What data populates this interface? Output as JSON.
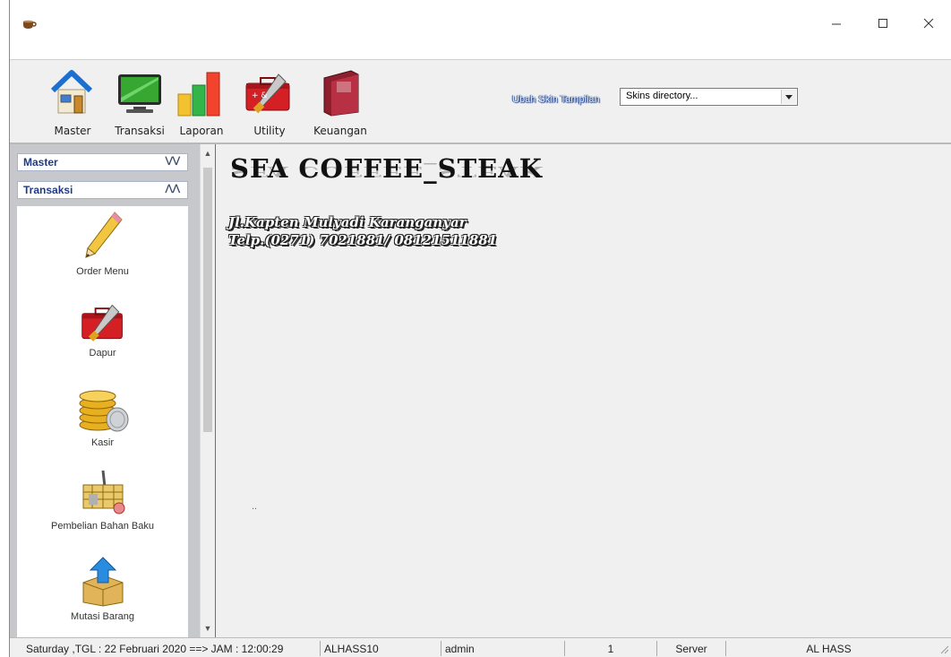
{
  "window": {
    "title": ""
  },
  "toolbar": {
    "buttons": [
      {
        "label": "Master"
      },
      {
        "label": "Transaksi"
      },
      {
        "label": "Laporan"
      },
      {
        "label": "Utility"
      },
      {
        "label": "Keuangan"
      }
    ],
    "skin_label": "Ubah Skin Tampilan",
    "skin_select_value": "Skins directory..."
  },
  "sidebar": {
    "groups": [
      {
        "label": "Master",
        "state": "collapsed"
      },
      {
        "label": "Transaksi",
        "state": "expanded"
      }
    ],
    "items": [
      {
        "label": "Order Menu",
        "icon": "pencil-icon"
      },
      {
        "label": "Dapur",
        "icon": "toolbox-icon"
      },
      {
        "label": "Kasir",
        "icon": "coins-icon"
      },
      {
        "label": "Pembelian Bahan Baku",
        "icon": "basket-icon"
      },
      {
        "label": "Mutasi Barang",
        "icon": "box-arrow-icon"
      }
    ]
  },
  "content": {
    "brand": "SFA COFFEE_STEAK",
    "address": "Jl.Kapten Mulyadi Karanganyar",
    "phone": "Telp.(0271) 7021881/ 08121511881",
    "dots": ".."
  },
  "statusbar": {
    "datetime": "Saturday ,TGL : 22 Februari 2020 ==> JAM : 12:00:29",
    "computer": "ALHASS10",
    "user": "admin",
    "number": "1",
    "server": "Server",
    "company": "AL HASS"
  },
  "colors": {
    "window_bg": "#f0f0f0",
    "sidebar_bg": "#c6c8cc",
    "group_header_text": "#1e3a82",
    "skin_label_outline": "#1d3f8a"
  }
}
